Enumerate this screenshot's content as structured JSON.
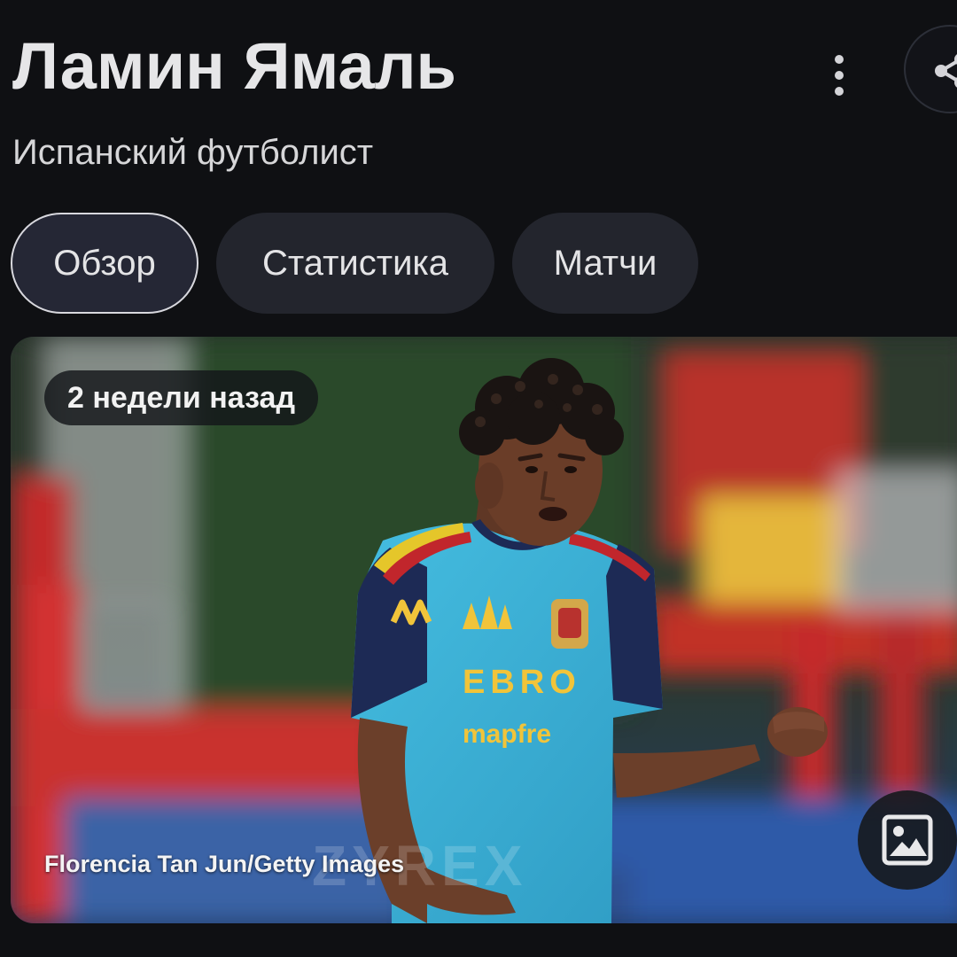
{
  "header": {
    "title": "Ламин Ямаль",
    "subtitle": "Испанский футболист",
    "more_icon": "more-vert-icon",
    "share_icon": "share-icon"
  },
  "tabs": [
    {
      "label": "Обзор",
      "active": true
    },
    {
      "label": "Статистика",
      "active": false
    },
    {
      "label": "Матчи",
      "active": false
    }
  ],
  "hero": {
    "time_badge": "2 недели назад",
    "credit": "Florencia Tan Jun/Getty Images",
    "watermark": "ZYREX",
    "image_button_icon": "image-icon",
    "jersey_text": "EBRO",
    "jersey_sponsor": "mapfre"
  },
  "colors": {
    "background": "#0f1013",
    "tab_bg": "#23252d",
    "tab_active_border": "#d8d8de",
    "jersey": "#3fb3d6"
  }
}
